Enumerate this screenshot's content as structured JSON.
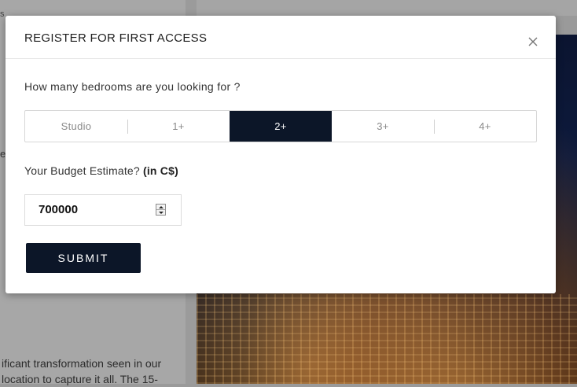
{
  "background": {
    "text_fragments": [
      "ificant transformation seen in our",
      " location to capture it all. The 15-"
    ],
    "partial_left_letter": "e",
    "partial_top_letter": "s"
  },
  "modal": {
    "title": "REGISTER FOR FIRST ACCESS",
    "close_icon": "close-icon",
    "bedrooms_question": "How many bedrooms are you looking for ?",
    "bedroom_options": [
      "Studio",
      "1+",
      "2+",
      "3+",
      "4+"
    ],
    "selected_bedroom": "2+",
    "budget_label": "Your Budget Estimate?",
    "budget_unit": "(in C$)",
    "budget_value": "700000",
    "submit_label": "SUBMIT"
  },
  "colors": {
    "accent": "#0c1628",
    "overlay": "#9a9a9a"
  }
}
